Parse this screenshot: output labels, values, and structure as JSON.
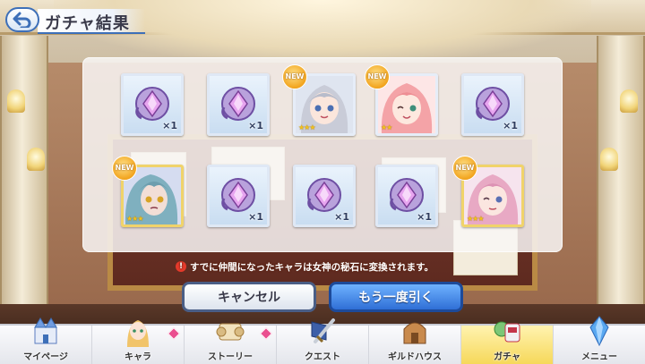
{
  "header": {
    "title": "ガチャ結果",
    "back_icon": "back-arrow-icon"
  },
  "results": {
    "row1": [
      {
        "kind": "item",
        "icon": "goddess-stone-icon",
        "qty": "×1"
      },
      {
        "kind": "item",
        "icon": "goddess-stone-icon",
        "qty": "×1"
      },
      {
        "kind": "character",
        "badge": "NEW",
        "stars": "★★★"
      },
      {
        "kind": "character",
        "badge": "NEW",
        "stars": "★★"
      },
      {
        "kind": "item",
        "icon": "goddess-stone-icon",
        "qty": "×1"
      }
    ],
    "row2": [
      {
        "kind": "character",
        "badge": "NEW",
        "stars": "★★★"
      },
      {
        "kind": "item",
        "icon": "goddess-stone-icon",
        "qty": "×1"
      },
      {
        "kind": "item",
        "icon": "goddess-stone-icon",
        "qty": "×1"
      },
      {
        "kind": "item",
        "icon": "goddess-stone-icon",
        "qty": "×1"
      },
      {
        "kind": "character",
        "badge": "NEW",
        "stars": "★★★"
      }
    ]
  },
  "notice": {
    "icon": "!",
    "text": "すでに仲間になったキャラは女神の秘石に変換されます。"
  },
  "buttons": {
    "cancel": "キャンセル",
    "again": "もう一度引く"
  },
  "nav": [
    {
      "label": "マイページ",
      "icon": "castle-icon"
    },
    {
      "label": "キャラ",
      "icon": "character-icon"
    },
    {
      "label": "ストーリー",
      "icon": "scroll-icon"
    },
    {
      "label": "クエスト",
      "icon": "sword-icon"
    },
    {
      "label": "ギルドハウス",
      "icon": "guild-house-icon"
    },
    {
      "label": "ガチャ",
      "icon": "gacha-icon",
      "active": true
    },
    {
      "label": "メニュー",
      "icon": "crystal-icon"
    }
  ],
  "colors": {
    "accent": "#3d6fb8",
    "new_badge": "#f2a41e",
    "active_tab": "#f6d85a",
    "notice_icon": "#e53a2b"
  }
}
